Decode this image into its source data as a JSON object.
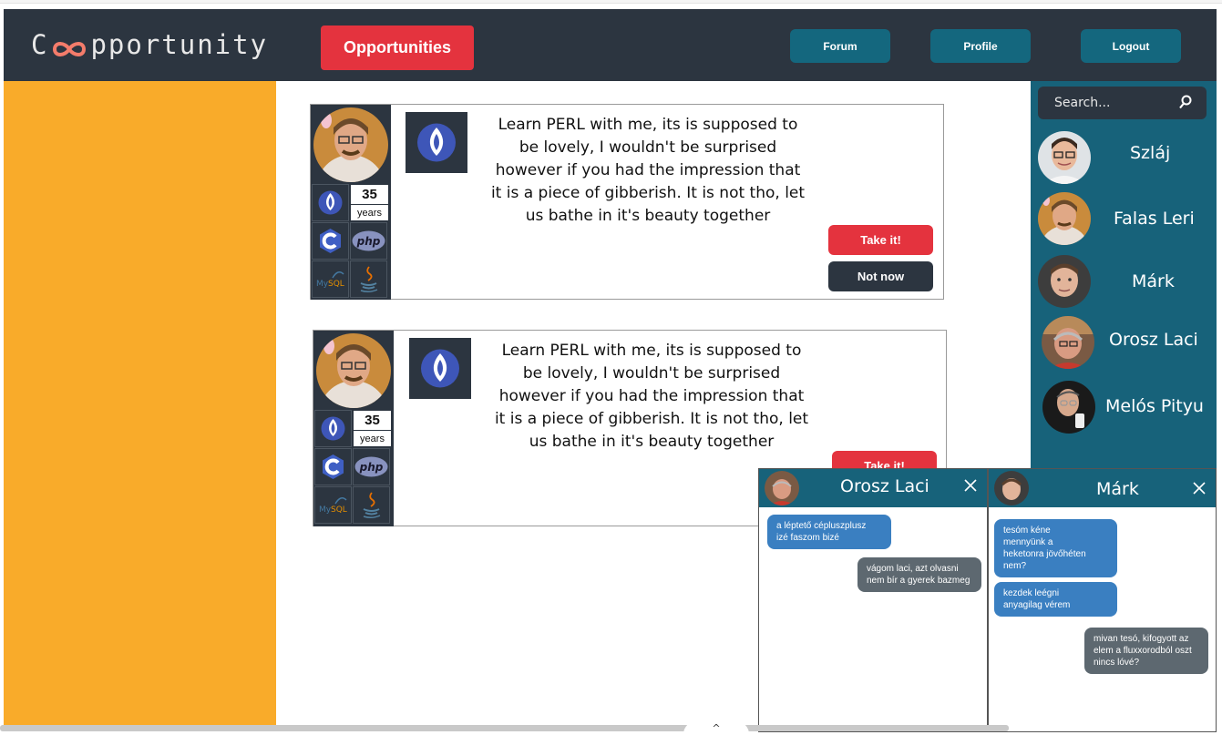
{
  "header": {
    "logo_prefix": "C",
    "logo_suffix": "pportunity",
    "opportunities_label": "Opportunities",
    "forum_label": "Forum",
    "profile_label": "Profile",
    "logout_label": "Logout"
  },
  "colors": {
    "header_bg": "#2c3540",
    "accent_red": "#e4333e",
    "nav_teal": "#14677e",
    "left_panel": "#f9ab2a",
    "sidebar": "#17627a",
    "bubble_in": "#3a7fc1",
    "bubble_out": "#5d6870"
  },
  "search": {
    "placeholder": "Search..."
  },
  "contacts": [
    {
      "name": "Szláj"
    },
    {
      "name": "Falas Leri"
    },
    {
      "name": "Márk"
    },
    {
      "name": "Orosz Laci"
    },
    {
      "name": "Melós Pityu"
    }
  ],
  "cards": [
    {
      "age": "35",
      "age_unit": "years",
      "skills": [
        "perl-icon",
        "c-icon",
        "php-icon",
        "mysql-icon",
        "java-icon"
      ],
      "lines": [
        "Learn PERL with me, its is supposed to",
        "be lovely, I wouldn't be surprised",
        "however if you had the impression that",
        "it is a piece of gibberish. It is not tho, let",
        "us bathe in it's beauty together"
      ],
      "take_label": "Take it!",
      "notnow_label": "Not now"
    },
    {
      "age": "35",
      "age_unit": "years",
      "skills": [
        "perl-icon",
        "c-icon",
        "php-icon",
        "mysql-icon",
        "java-icon"
      ],
      "lines": [
        "Learn PERL with me, its is supposed to",
        "be lovely, I wouldn't be surprised",
        "however if you had the impression that",
        "it is a piece of gibberish. It is not tho, let",
        "us bathe in it's beauty together"
      ],
      "take_label": "Take it!"
    }
  ],
  "chats": [
    {
      "title": "Orosz Laci",
      "messages": [
        {
          "from": "them",
          "lines": [
            "a léptető cépluszplusz",
            "izé faszom bizé"
          ]
        },
        {
          "from": "me",
          "lines": [
            "vágom laci, azt olvasni",
            "nem bír a gyerek bazmeg"
          ]
        }
      ]
    },
    {
      "title": "Márk",
      "messages": [
        {
          "from": "them",
          "lines": [
            "tesóm kéne",
            "mennyünk a",
            "heketonra jövőhéten",
            "nem?"
          ]
        },
        {
          "from": "them",
          "lines": [
            "kezdek leégni",
            "anyagilag vérem"
          ]
        },
        {
          "from": "me",
          "lines": [
            "mivan tesó, kifogyott az",
            "elem a fluxxorodból oszt",
            "nincs lóvé?"
          ]
        }
      ]
    }
  ],
  "scroll_caret": "^"
}
